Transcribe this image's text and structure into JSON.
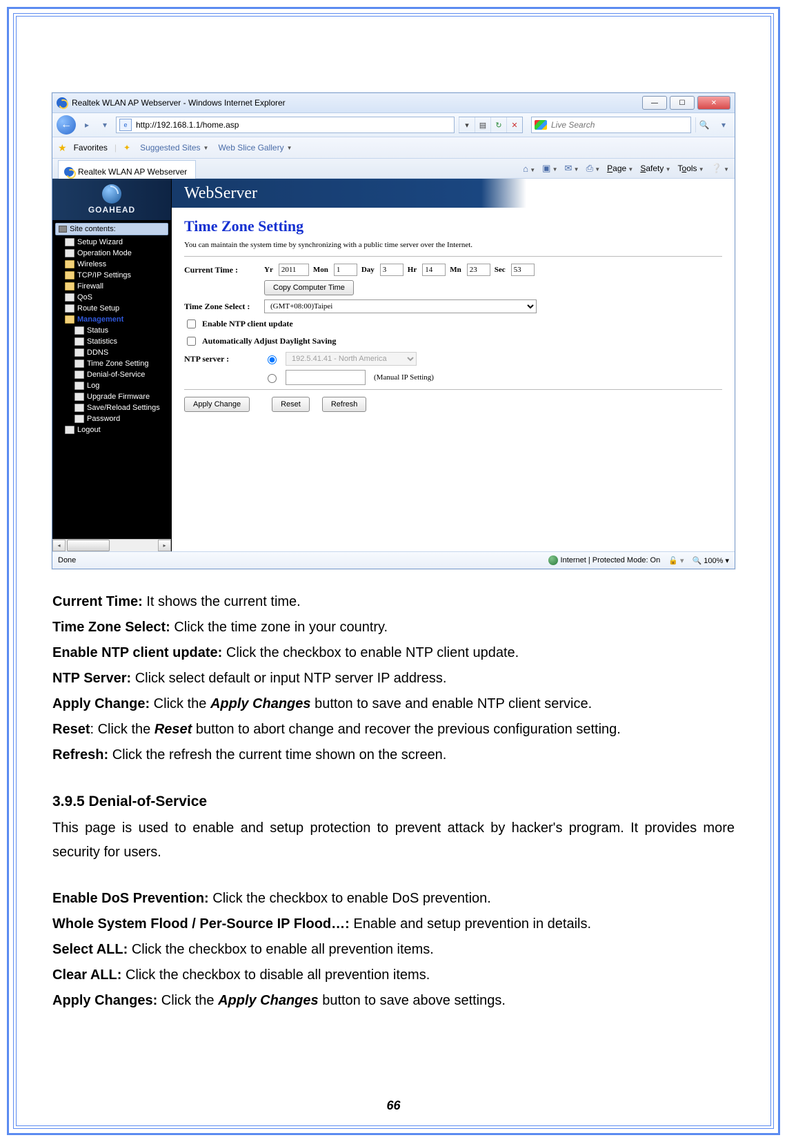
{
  "window": {
    "title": "Realtek WLAN AP Webserver - Windows Internet Explorer",
    "url": "http://192.168.1.1/home.asp",
    "search_placeholder": "Live Search",
    "favorites_label": "Favorites",
    "suggested_sites_label": "Suggested Sites",
    "web_slice_label": "Web Slice Gallery",
    "tab_label": "Realtek WLAN AP Webserver",
    "cmd_page": "Page",
    "cmd_safety": "Safety",
    "cmd_tools": "Tools",
    "status_done": "Done",
    "status_zone": "Internet | Protected Mode: On",
    "zoom": "100%"
  },
  "sidebar": {
    "brand": "GOAHEAD",
    "banner": "WebServer",
    "head": "Site contents:",
    "items": [
      "Setup Wizard",
      "Operation Mode",
      "Wireless",
      "TCP/IP Settings",
      "Firewall",
      "QoS",
      "Route Setup",
      "Management",
      "Status",
      "Statistics",
      "DDNS",
      "Time Zone Setting",
      "Denial-of-Service",
      "Log",
      "Upgrade Firmware",
      "Save/Reload Settings",
      "Password",
      "Logout"
    ]
  },
  "form": {
    "title": "Time Zone Setting",
    "desc": "You can maintain the system time by synchronizing with a public time server over the Internet.",
    "current_time_label": "Current Time :",
    "yr_label": "Yr",
    "yr": "2011",
    "mon_label": "Mon",
    "mon": "1",
    "day_label": "Day",
    "day": "3",
    "hr_label": "Hr",
    "hr": "14",
    "mn_label": "Mn",
    "mn": "23",
    "sec_label": "Sec",
    "sec": "53",
    "copy_btn": "Copy Computer Time",
    "tz_label": "Time Zone Select :",
    "tz_value": "(GMT+08:00)Taipei",
    "ntp_enable_label": "Enable NTP client update",
    "dst_label": "Automatically Adjust Daylight Saving",
    "ntp_server_label": "NTP server :",
    "ntp_server_value": "192.5.41.41 - North America",
    "manual_label": "(Manual IP Setting)",
    "apply_btn": "Apply Change",
    "reset_btn": "Reset",
    "refresh_btn": "Refresh"
  },
  "doc": {
    "p1_b": "Current Time:",
    "p1": " It shows the current time.",
    "p2_b": "Time Zone Select:",
    "p2": " Click the time zone in your country.",
    "p3_b": "Enable NTP client update:",
    "p3": " Click the checkbox to enable NTP client update.",
    "p4_b": "NTP Server:",
    "p4": " Click select default or input NTP server IP address.",
    "p5_b": "Apply Change:",
    "p5a": " Click the ",
    "p5_bi": "Apply Changes",
    "p5b": " button to save and enable NTP client service.",
    "p6_b": "Reset",
    "p6a": ": Click the ",
    "p6_bi": "Reset",
    "p6b": " button to abort change and recover the previous configuration setting.",
    "p7_b": "Refresh:",
    "p7": " Click the refresh the current time shown on the screen.",
    "section": "3.9.5  Denial-of-Service",
    "section_desc": "This page is used to enable and setup protection to prevent attack by hacker's program. It provides more security for users.",
    "p8_b": "Enable DoS Prevention:",
    "p8": " Click the checkbox to enable DoS prevention.",
    "p9_b": "Whole System Flood / Per-Source IP Flood…:",
    "p9": " Enable and setup prevention in details.",
    "p10_b": "Select ALL:",
    "p10": " Click the checkbox to enable all prevention items.",
    "p11_b": "Clear ALL:",
    "p11": " Click the checkbox to disable all prevention items.",
    "p12_b": "Apply Changes:",
    "p12a": " Click the ",
    "p12_bi": "Apply Changes",
    "p12b": " button to save above settings.",
    "pagenum": "66"
  }
}
